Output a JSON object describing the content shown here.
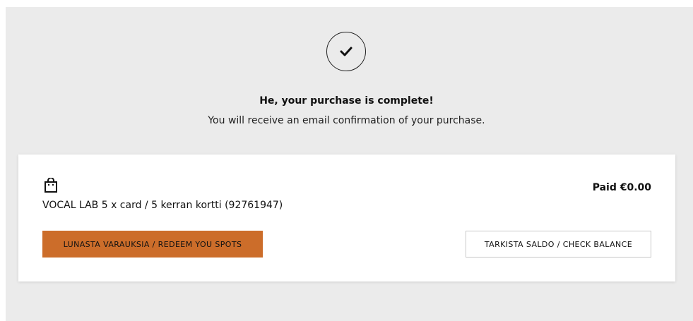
{
  "confirmation": {
    "title": "He, your purchase is complete!",
    "subtitle": "You will receive an email confirmation of your purchase.",
    "icon": "checkmark-icon"
  },
  "order": {
    "icon": "shopping-bag-icon",
    "product_name": "VOCAL LAB 5 x card / 5 kerran kortti (92761947)",
    "paid_label": "Paid €0.00",
    "redeem_button_label": "LUNASTA VARAUKSIA / REDEEM YOU SPOTS",
    "check_balance_button_label": "TARKISTA SALDO / CHECK BALANCE"
  },
  "colors": {
    "background": "#ebebeb",
    "card": "#ffffff",
    "accent": "#cc6d2a"
  }
}
